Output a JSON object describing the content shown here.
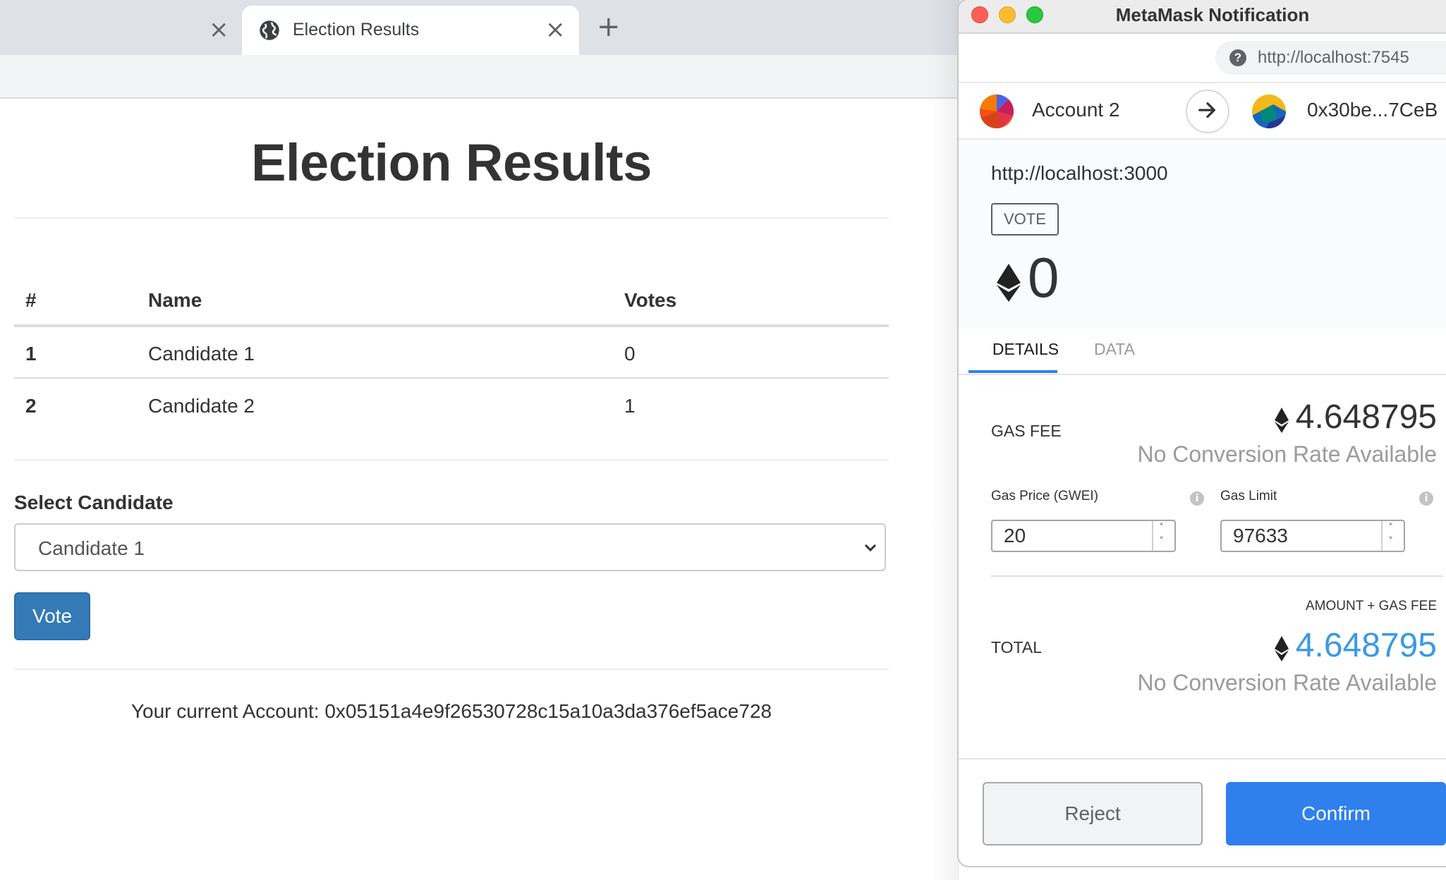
{
  "browser": {
    "tab_title": "Election Results",
    "previous_tab_close": "×",
    "active_tab_close": "×",
    "new_tab": "+"
  },
  "page": {
    "title": "Election Results",
    "table": {
      "headers": [
        "#",
        "Name",
        "Votes"
      ],
      "rows": [
        {
          "num": "1",
          "name": "Candidate 1",
          "votes": "0"
        },
        {
          "num": "2",
          "name": "Candidate 2",
          "votes": "1"
        }
      ]
    },
    "select_label": "Select Candidate",
    "select_value": "Candidate 1",
    "vote_button": "Vote",
    "account_text": "Your current Account: 0x05151a4e9f26530728c15a10a3da376ef5ace728"
  },
  "metamask": {
    "window_title": "MetaMask Notification",
    "network_origin": "http://localhost:7545",
    "from_account": "Account 2",
    "to_address": "0x30be...7CeB",
    "site_origin": "http://localhost:3000",
    "method": "VOTE",
    "amount": "0",
    "tabs": {
      "details": "DETAILS",
      "data": "DATA"
    },
    "gas_fee_label": "GAS FEE",
    "gas_fee_value": "4.648795",
    "no_conversion": "No Conversion Rate Available",
    "gas_price_label": "Gas Price (GWEI)",
    "gas_price_value": "20",
    "gas_limit_label": "Gas Limit",
    "gas_limit_value": "97633",
    "amount_gas_label": "AMOUNT + GAS FEE",
    "total_label": "TOTAL",
    "total_value": "4.648795",
    "reject_button": "Reject",
    "confirm_button": "Confirm",
    "accent_color": "#2f80ed",
    "total_color": "#3b99e3"
  },
  "icons": {
    "tab_icon": "globe-icon",
    "help_icon": "question-icon",
    "arrow_icon": "arrow-right-icon",
    "currency_icon": "ethereum-icon",
    "info_icon": "info-icon",
    "select_icon": "chevron-down-icon"
  }
}
